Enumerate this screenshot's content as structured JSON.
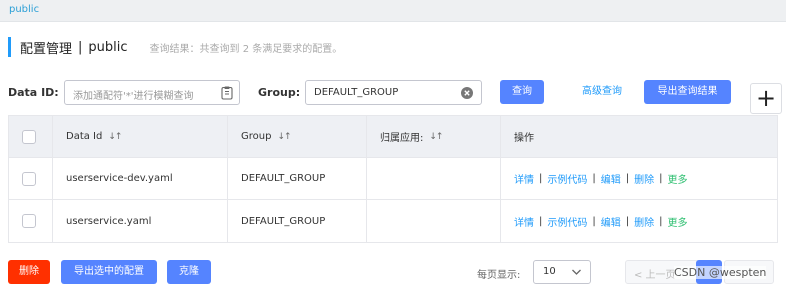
{
  "namespace_bar": {
    "active": "public"
  },
  "header": {
    "title": "配置管理",
    "separator": "|",
    "namespace": "public",
    "result_info": "查询结果：共查询到 2 条满足要求的配置。"
  },
  "filter": {
    "data_id_label": "Data ID:",
    "data_id_placeholder": "添加通配符'*'进行模糊查询",
    "group_label": "Group:",
    "group_value": "DEFAULT_GROUP",
    "search_label": "查询",
    "advanced_label": "高级查询",
    "export_label": "导出查询结果",
    "add_label": "+"
  },
  "table": {
    "headers": [
      "Data Id",
      "Group",
      "归属应用:",
      "操作"
    ],
    "sort_glyph": "↓↑",
    "rows": [
      {
        "data_id": "userservice-dev.yaml",
        "group": "DEFAULT_GROUP",
        "app": ""
      },
      {
        "data_id": "userservice.yaml",
        "group": "DEFAULT_GROUP",
        "app": ""
      }
    ],
    "operations": [
      "详情",
      "示例代码",
      "编辑",
      "删除",
      "更多"
    ],
    "op_separator": "|"
  },
  "footer": {
    "delete_label": "删除",
    "export_selected_label": "导出选中的配置",
    "clone_label": "克隆",
    "page_size_label": "每页显示:",
    "page_size_value": "10",
    "prev_label": "< 上一页"
  },
  "watermark": "CSDN @wespten",
  "colors": {
    "primary": "#5584ff",
    "link": "#209bfa",
    "danger": "#ff3000",
    "more": "#2fbf71"
  }
}
